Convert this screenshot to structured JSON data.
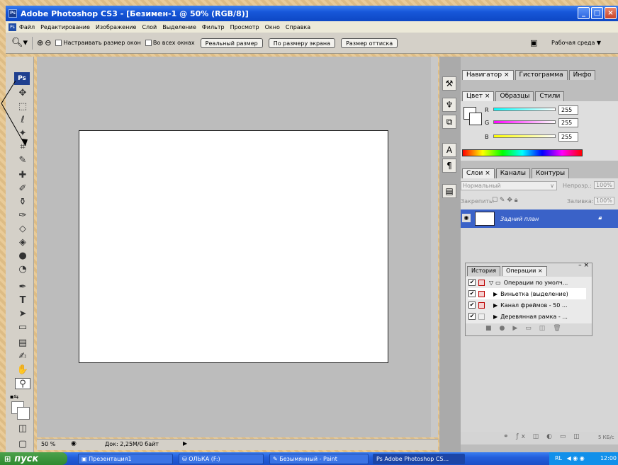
{
  "window": {
    "title": "Adobe Photoshop CS3 - [Безимен-1 @ 50% (RGB/8)]",
    "logo": "Ps"
  },
  "menu": [
    "Файл",
    "Редактирование",
    "Изображение",
    "Слой",
    "Выделение",
    "Фильтр",
    "Просмотр",
    "Окно",
    "Справка"
  ],
  "options": {
    "fit_windows": "Настраивать размер окон",
    "all_windows": "Во всех окнах",
    "actual_pixels": "Реальный размер",
    "fit_screen": "По размеру экрана",
    "print_size": "Размер оттиска",
    "workspace": "Рабочая среда ▼"
  },
  "toolbox": {
    "label": "Ps"
  },
  "status": {
    "zoom": "50 %",
    "doc": "Док: 2,25M/0 байт"
  },
  "navigator_tabs": [
    "Навигатор ×",
    "Гистограмма",
    "Инфо"
  ],
  "color_tabs": [
    "Цвет ×",
    "Образцы",
    "Стили"
  ],
  "color": {
    "r_label": "R",
    "g_label": "G",
    "b_label": "B",
    "r": "255",
    "g": "255",
    "b": "255"
  },
  "layers_tabs": [
    "Слои ×",
    "Каналы",
    "Контуры"
  ],
  "layers": {
    "blend": "Нормальный",
    "opacity_label": "Непрозр.:",
    "opacity": "100%",
    "lock_label": "Закрепить:",
    "fill_label": "Заливка:",
    "fill": "100%",
    "layer_name": "Задний план"
  },
  "actions_tabs": [
    "История",
    "Операции ×"
  ],
  "actions": [
    {
      "label": "Операции по умолч..."
    },
    {
      "label": "Виньетка (выделение)"
    },
    {
      "label": "Канал фреймов - 50 ..."
    },
    {
      "label": "Деревянная рамка - ..."
    }
  ],
  "layer_status": "5 КБ/с",
  "taskbar": {
    "start": "пуск",
    "items": [
      "Презентация1",
      "ОЛЬКА (F:)",
      "Безымянный - Paint",
      "Adobe Photoshop CS..."
    ],
    "tray": "RL",
    "clock": "12:00"
  }
}
